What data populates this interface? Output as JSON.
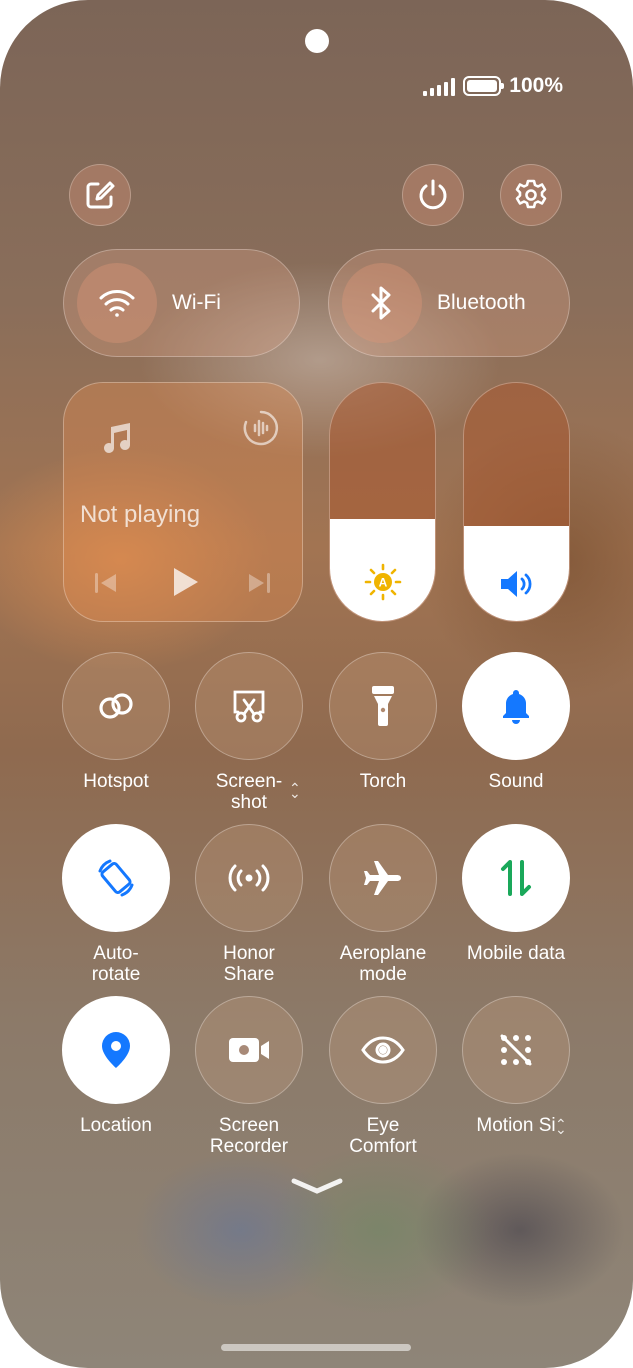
{
  "status": {
    "battery_text": "100%"
  },
  "top_buttons": [
    "edit",
    "power",
    "settings"
  ],
  "connectivity": [
    {
      "label": "Wi-Fi",
      "icon": "wifi-icon"
    },
    {
      "label": "Bluetooth",
      "icon": "bluetooth-icon"
    }
  ],
  "media": {
    "status": "Not playing"
  },
  "sliders": {
    "brightness_level": 0.43,
    "volume_level": 0.4
  },
  "tiles": [
    {
      "label": "Hotspot",
      "icon": "hotspot-icon",
      "on": false
    },
    {
      "label": "Screen-\nshot",
      "icon": "screenshot-icon",
      "on": false
    },
    {
      "label": "Torch",
      "icon": "torch-icon",
      "on": false
    },
    {
      "label": "Sound",
      "icon": "bell-icon",
      "on": true
    },
    {
      "label": "Auto-\nrotate",
      "icon": "auto-rotate-icon",
      "on": true
    },
    {
      "label": "Honor\nShare",
      "icon": "honor-share-icon",
      "on": false
    },
    {
      "label": "Aeroplane\nmode",
      "icon": "airplane-icon",
      "on": false
    },
    {
      "label": "Mobile data",
      "icon": "mobile-data-icon",
      "on": true
    },
    {
      "label": "Location",
      "icon": "location-icon",
      "on": true
    },
    {
      "label": "Screen\nRecorder",
      "icon": "screen-recorder-icon",
      "on": false
    },
    {
      "label": "Eye\nComfort",
      "icon": "eye-icon",
      "on": false
    },
    {
      "label": "Motion Si",
      "icon": "motion-sickness-icon",
      "on": false
    }
  ],
  "colors": {
    "accent_blue": "#1478ff",
    "mobile_data_green": "#1aa85a",
    "brightness_yellow": "#f0b400"
  }
}
